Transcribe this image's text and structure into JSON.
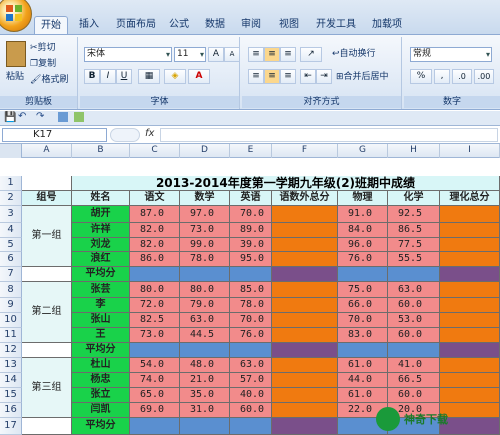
{
  "tabs": [
    "开始",
    "插入",
    "页面布局",
    "公式",
    "数据",
    "审阅",
    "视图",
    "开发工具",
    "加载项"
  ],
  "ribbon": {
    "clipboard": {
      "paste": "粘贴",
      "cut": "剪切",
      "copy": "复制",
      "format_painter": "格式刷",
      "label": "剪贴板"
    },
    "font": {
      "name": "宋体",
      "size": "11",
      "label": "字体"
    },
    "align": {
      "wrap": "自动换行",
      "merge": "合并后居中",
      "label": "对齐方式"
    },
    "number": {
      "format": "常规",
      "label": "数字"
    }
  },
  "name_box": "K17",
  "fx": "fx",
  "columns": [
    "A",
    "B",
    "C",
    "D",
    "E",
    "F",
    "G",
    "H",
    "I"
  ],
  "title": "2013-2014年度第一学期九年级(2)班期中成绩",
  "headers": [
    "组号",
    "姓名",
    "语文",
    "数学",
    "英语",
    "语数外总分",
    "物理",
    "化学",
    "理化总分"
  ],
  "groups": [
    "第一组",
    "第二组",
    "第三组"
  ],
  "avg_label": "平均分",
  "rows": [
    {
      "name": "胡开",
      "v": [
        "87.0",
        "97.0",
        "70.0"
      ],
      "p": [
        "91.0",
        "92.5"
      ]
    },
    {
      "name": "许祥",
      "v": [
        "82.0",
        "73.0",
        "89.0"
      ],
      "p": [
        "84.0",
        "86.5"
      ]
    },
    {
      "name": "刘龙",
      "v": [
        "82.0",
        "99.0",
        "39.0"
      ],
      "p": [
        "96.0",
        "77.5"
      ]
    },
    {
      "name": "浪红",
      "v": [
        "86.0",
        "78.0",
        "95.0"
      ],
      "p": [
        "76.0",
        "55.5"
      ]
    },
    {
      "name": "张芸",
      "v": [
        "80.0",
        "80.0",
        "85.0"
      ],
      "p": [
        "75.0",
        "63.0"
      ]
    },
    {
      "name": "李",
      "v": [
        "72.0",
        "79.0",
        "78.0"
      ],
      "p": [
        "66.0",
        "60.0"
      ]
    },
    {
      "name": "张山",
      "v": [
        "82.5",
        "63.0",
        "70.0"
      ],
      "p": [
        "70.0",
        "53.0"
      ]
    },
    {
      "name": "王",
      "v": [
        "73.0",
        "44.5",
        "76.0"
      ],
      "p": [
        "83.0",
        "60.0"
      ]
    },
    {
      "name": "杜山",
      "v": [
        "54.0",
        "48.0",
        "63.0"
      ],
      "p": [
        "61.0",
        "41.0"
      ]
    },
    {
      "name": "杨忠",
      "v": [
        "74.0",
        "21.0",
        "57.0"
      ],
      "p": [
        "44.0",
        "66.5"
      ]
    },
    {
      "name": "张立",
      "v": [
        "65.0",
        "35.0",
        "40.0"
      ],
      "p": [
        "61.0",
        "60.0"
      ]
    },
    {
      "name": "闫凯",
      "v": [
        "69.0",
        "31.0",
        "60.0"
      ],
      "p": [
        "22.0",
        "20.0"
      ]
    }
  ],
  "colors": {
    "title_bg": "#d8f6f7",
    "header_bg": "#d8f6f7",
    "name_bg": "#19d24a",
    "score_bg": "#f28b8b",
    "total_bg": "#f07a10",
    "avg_bg": "#5a8fd0",
    "avg_dark": "#7a4f8a",
    "group_bg": "#e6f7f7"
  },
  "watermark": "神奇下载"
}
